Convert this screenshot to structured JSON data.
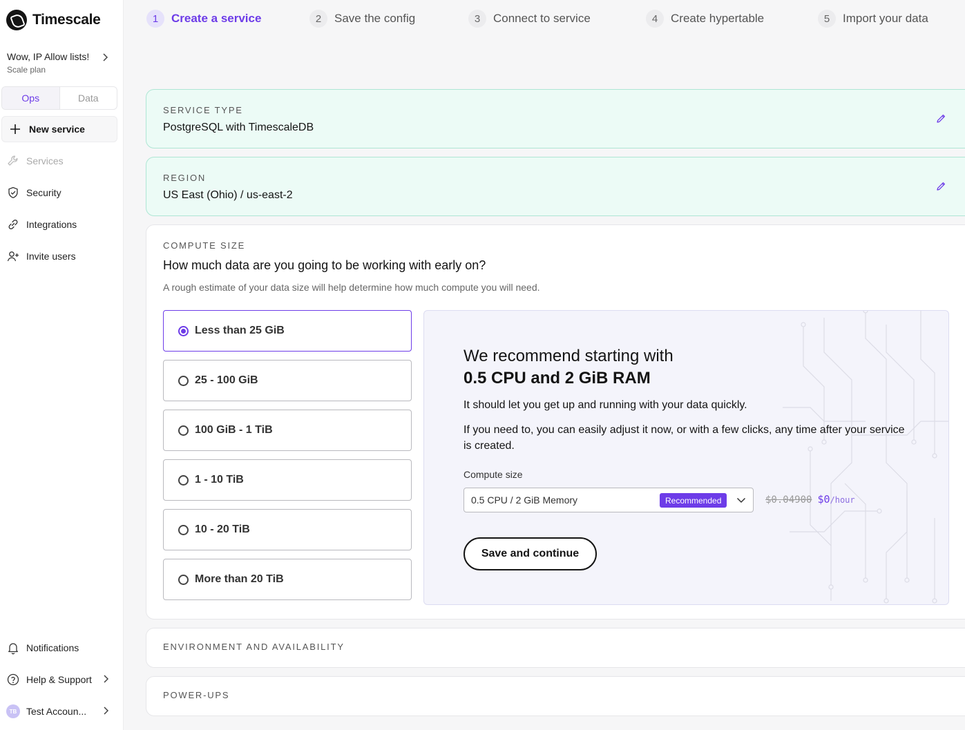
{
  "brand": {
    "name": "Timescale",
    "accent": "#6d3ce8"
  },
  "project": {
    "name": "Wow, IP Allow lists!",
    "plan": "Scale plan"
  },
  "tabs": [
    {
      "label": "Ops",
      "active": true
    },
    {
      "label": "Data",
      "active": false
    }
  ],
  "new_service_label": "New service",
  "nav": {
    "services": "Services",
    "security": "Security",
    "integrations": "Integrations",
    "invite": "Invite users",
    "notifications": "Notifications",
    "help": "Help & Support",
    "account": "Test Accoun...",
    "account_initials": "TB"
  },
  "steps": [
    {
      "num": "1",
      "label": "Create a service",
      "active": true
    },
    {
      "num": "2",
      "label": "Save the config",
      "active": false
    },
    {
      "num": "3",
      "label": "Connect to service",
      "active": false
    },
    {
      "num": "4",
      "label": "Create hypertable",
      "active": false
    },
    {
      "num": "5",
      "label": "Import your data",
      "active": false
    }
  ],
  "service_type": {
    "kicker": "SERVICE TYPE",
    "value": "PostgreSQL with TimescaleDB"
  },
  "region": {
    "kicker": "REGION",
    "value": "US East (Ohio) / us-east-2"
  },
  "compute": {
    "kicker": "COMPUTE SIZE",
    "question": "How much data are you going to be working with early on?",
    "hint": "A rough estimate of your data size will help determine how much compute you will need.",
    "options": [
      {
        "label": "Less than 25 GiB",
        "selected": true
      },
      {
        "label": "25 - 100 GiB",
        "selected": false
      },
      {
        "label": "100 GiB - 1 TiB",
        "selected": false
      },
      {
        "label": "1 - 10 TiB",
        "selected": false
      },
      {
        "label": "10 - 20 TiB",
        "selected": false
      },
      {
        "label": "More than 20 TiB",
        "selected": false
      }
    ],
    "recommend_line1": "We recommend starting with",
    "recommend_line2": "0.5 CPU and 2 GiB RAM",
    "para1": "It should let you get up and running with your data quickly.",
    "para2": "If you need to, you can easily adjust it now, or with a few clicks, any time after your service is created.",
    "size_label": "Compute size",
    "size_value": "0.5 CPU / 2 GiB Memory",
    "badge": "Recommended",
    "price_old": "$0.04900",
    "price_new": "$0",
    "price_unit": "/hour",
    "save_label": "Save and continue"
  },
  "environment_kicker": "ENVIRONMENT AND AVAILABILITY",
  "powerups_kicker": "POWER-UPS"
}
